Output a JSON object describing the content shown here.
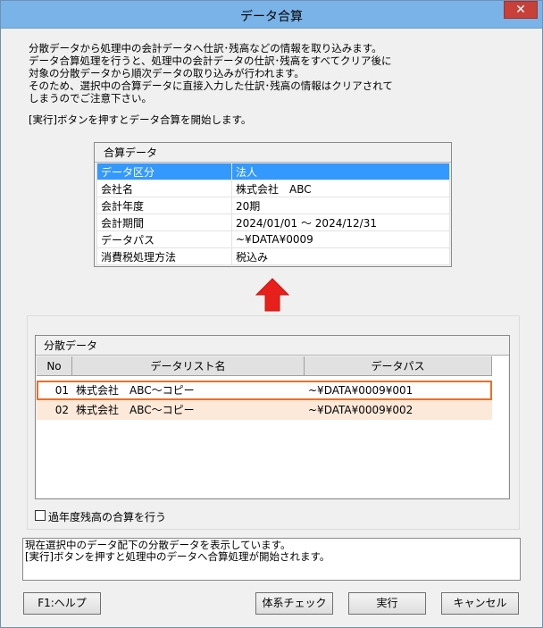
{
  "window": {
    "title": "データ合算",
    "close_glyph": "✕"
  },
  "intro": {
    "text": "分散データから処理中の会計データへ仕訳･残高などの情報を取り込みます。\nデータ合算処理を行うと、処理中の会計データの仕訳･残高をすべてクリア後に\n対象の分散データから順次データの取り込みが行われます。\nそのため、選択中の合算データに直接入力した仕訳･残高の情報はクリアされて\nしまうのでご注意下さい。",
    "note": "[実行]ボタンを押すとデータ合算を開始します。"
  },
  "merge": {
    "header": "合算データ",
    "rows": [
      {
        "key": "データ区分",
        "value": "法人"
      },
      {
        "key": "会社名",
        "value": "株式会社　ABC"
      },
      {
        "key": "会計年度",
        "value": "20期"
      },
      {
        "key": "会計期間",
        "value": "2024/01/01 ～ 2024/12/31"
      },
      {
        "key": "データパス",
        "value": "~¥DATA¥0009"
      },
      {
        "key": "消費税処理方法",
        "value": "税込み"
      }
    ],
    "arrow_color": "#e8201c"
  },
  "dist": {
    "header": "分散データ",
    "columns": [
      "No",
      "データリスト名",
      "データパス"
    ],
    "rows": [
      {
        "no": "01",
        "name": "株式会社　ABC～コピー",
        "path": "~¥DATA¥0009¥001"
      },
      {
        "no": "02",
        "name": "株式会社　ABC～コピー",
        "path": "~¥DATA¥0009¥002"
      }
    ],
    "focus_color": "#e8702a"
  },
  "option": {
    "label": "過年度残高の合算を行う",
    "checked": false
  },
  "status": {
    "text": "現在選択中のデータ配下の分散データを表示しています。\n[実行]ボタンを押すと処理中のデータへ合算処理が開始されます。"
  },
  "buttons": {
    "help": "F1:ヘルプ",
    "check": "体系チェック",
    "run": "実行",
    "cancel": "キャンセル"
  }
}
